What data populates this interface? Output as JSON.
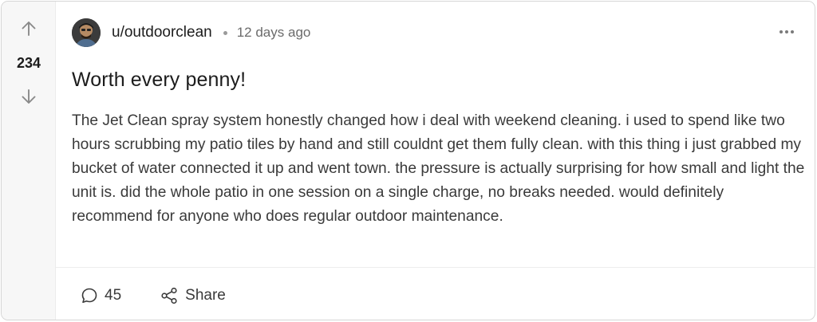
{
  "vote": {
    "count": "234",
    "upvote_icon": "arrow-up-icon",
    "downvote_icon": "arrow-down-icon"
  },
  "post": {
    "author": "u/outdoorclean",
    "timestamp": "12 days ago",
    "title": "Worth every penny!",
    "body": "The Jet Clean spray system honestly changed how i deal with weekend cleaning. i used to spend like two hours scrubbing my patio tiles by hand and still couldnt get them fully clean. with this thing i just grabbed my bucket of water connected it up and went town. the pressure is actually surprising for how small and light the unit is. did the whole patio in one session on a single charge, no breaks needed. would definitely recommend for anyone who does regular outdoor maintenance."
  },
  "footer": {
    "comment_count": "45",
    "share_label": "Share"
  },
  "colors": {
    "rail_background": "#f7f7f7",
    "text_primary": "#1c1c1c",
    "text_secondary": "#6b6b6b",
    "border": "#d6d6d6"
  }
}
